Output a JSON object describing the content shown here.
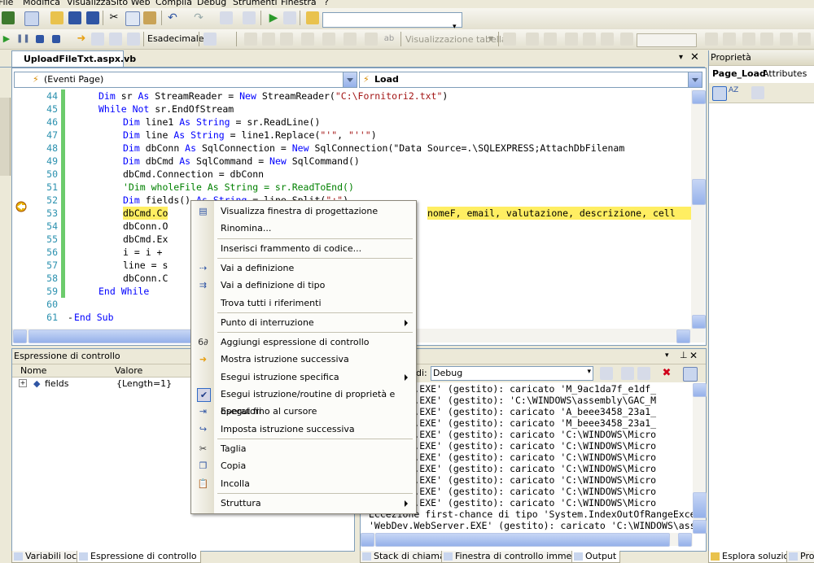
{
  "menubar": [
    "File",
    "Modifica",
    "Visualizza",
    "Sito Web",
    "Compila",
    "Debug",
    "Strumenti",
    "Finestra",
    "?"
  ],
  "toolbar": {
    "hex_label": "Esadecimale",
    "table_view": "Visualizzazione tabella"
  },
  "document_tab": "UploadFileTxt.aspx.vb",
  "editor": {
    "object_combo": "(Eventi Page)",
    "method_combo": "Load",
    "lines": [
      {
        "n": "44",
        "t": "Dim sr As StreamReader = New StreamReader(\"C:\\Fornitori2.txt\")"
      },
      {
        "n": "45",
        "t": "While Not sr.EndOfStream"
      },
      {
        "n": "46",
        "t": "Dim line1 As String = sr.ReadLine()"
      },
      {
        "n": "47",
        "t": "Dim line As String = line1.Replace(\"'\", \"''\")"
      },
      {
        "n": "48",
        "t": "Dim dbConn As SqlConnection = New SqlConnection(\"Data Source=.\\SQLEXPRESS;AttachDbFilenam"
      },
      {
        "n": "49",
        "t": "Dim dbCmd As SqlCommand = New SqlCommand()"
      },
      {
        "n": "50",
        "t": "dbCmd.Connection = dbConn"
      },
      {
        "n": "51",
        "t": "'Dim wholeFile As String = sr.ReadToEnd()"
      },
      {
        "n": "52",
        "t": "Dim fields() As String = line.Split(\";\")"
      },
      {
        "n": "53",
        "t": "dbCmd.Co",
        "tail": "nomeF, email, valutazione, descrizione, cell"
      },
      {
        "n": "54",
        "t": "dbConn.O"
      },
      {
        "n": "55",
        "t": "dbCmd.Ex"
      },
      {
        "n": "56",
        "t": "i = i +"
      },
      {
        "n": "57",
        "t": "line = s"
      },
      {
        "n": "58",
        "t": "dbConn.C"
      },
      {
        "n": "59",
        "t": "End While"
      },
      {
        "n": "60",
        "t": ""
      },
      {
        "n": "61",
        "t": "End Sub"
      }
    ]
  },
  "properties": {
    "title": "Proprietà",
    "object": "Page_Load",
    "object_type": "Attributes"
  },
  "watch": {
    "title": "Espressione di controllo",
    "col_name": "Nome",
    "col_value": "Valore",
    "rows": [
      {
        "name": "fields",
        "value": "{Length=1}"
      }
    ]
  },
  "output": {
    "show_label": "di:",
    "source": "Debug",
    "lines": [
      "ebServer.EXE' (gestito): caricato 'M_9ac1da7f_e1df_",
      "ebServer.EXE' (gestito): 'C:\\WINDOWS\\assembly\\GAC_M",
      "ebServer.EXE' (gestito): caricato 'A_beee3458_23a1_",
      "ebServer.EXE' (gestito): caricato 'M_beee3458_23a1_",
      "ebServer.EXE' (gestito): caricato 'C:\\WINDOWS\\Micro",
      "ebServer.EXE' (gestito): caricato 'C:\\WINDOWS\\Micro",
      "ebServer.EXE' (gestito): caricato 'C:\\WINDOWS\\Micro",
      "ebServer.EXE' (gestito): caricato 'C:\\WINDOWS\\Micro",
      "ebServer.EXE' (gestito): caricato 'C:\\WINDOWS\\Micro",
      "ebServer.EXE' (gestito): caricato 'C:\\WINDOWS\\Micro",
      "ebServer.EXE' (gestito): caricato 'C:\\WINDOWS\\Micro",
      "Eccezione first-chance di tipo 'System.IndexOutOfRangeExcept",
      "'WebDev.WebServer.EXE' (gestito): caricato 'C:\\WINDOWS\\assem"
    ]
  },
  "bottom_tabs_left": [
    "Variabili locali",
    "Espressione di controllo"
  ],
  "bottom_tabs_right": [
    "Stack di chiamate",
    "Finestra di controllo immediato",
    "Output"
  ],
  "bottom_tabs_props": [
    "Esplora soluzioni",
    "Pro"
  ],
  "context_menu": [
    {
      "label": "Visualizza finestra di progettazione",
      "icon": "designer-icon"
    },
    {
      "label": "Rinomina..."
    },
    {
      "sep": true
    },
    {
      "label": "Inserisci frammento di codice..."
    },
    {
      "sep": true
    },
    {
      "label": "Vai a definizione",
      "icon": "goto-definition-icon"
    },
    {
      "label": "Vai a definizione di tipo",
      "icon": "goto-type-icon"
    },
    {
      "label": "Trova tutti i riferimenti"
    },
    {
      "sep": true
    },
    {
      "label": "Punto di interruzione",
      "submenu": true
    },
    {
      "sep": true
    },
    {
      "label": "Aggiungi espressione di controllo",
      "icon": "watch-icon"
    },
    {
      "label": "Mostra istruzione successiva",
      "icon": "arrow-icon"
    },
    {
      "label": "Esegui istruzione specifica",
      "submenu": true
    },
    {
      "label": "Esegui istruzione/routine di proprietà e operatori",
      "icon": "check-icon",
      "checked": true
    },
    {
      "label": "Esegui fino al cursore",
      "icon": "run-to-cursor-icon"
    },
    {
      "label": "Imposta istruzione successiva",
      "icon": "set-next-icon"
    },
    {
      "sep": true
    },
    {
      "label": "Taglia",
      "icon": "scissors-icon"
    },
    {
      "label": "Copia",
      "icon": "copy-icon"
    },
    {
      "label": "Incolla",
      "icon": "paste-icon"
    },
    {
      "sep": true
    },
    {
      "label": "Struttura",
      "submenu": true
    }
  ]
}
